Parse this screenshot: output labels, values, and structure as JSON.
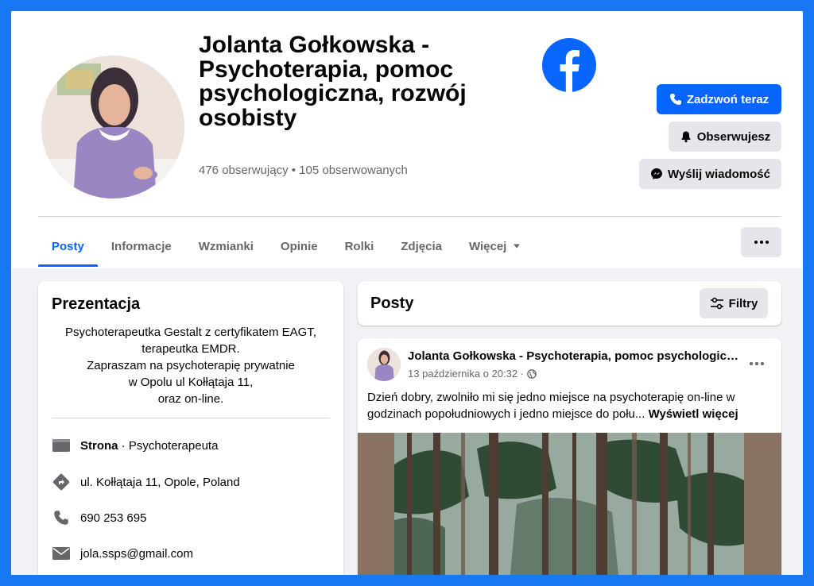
{
  "header": {
    "page_title": "Jolanta Gołkowska - Psychoterapia, pomoc psychologiczna, rozwój osobisty",
    "followers": "476 obserwujący • 105 obserwowanych"
  },
  "actions": {
    "call_label": "Zadzwoń teraz",
    "follow_label": "Obserwujesz",
    "message_label": "Wyślij wiadomość"
  },
  "tabs": [
    {
      "label": "Posty",
      "active": true
    },
    {
      "label": "Informacje"
    },
    {
      "label": "Wzmianki"
    },
    {
      "label": "Opinie"
    },
    {
      "label": "Rolki"
    },
    {
      "label": "Zdjęcia"
    },
    {
      "label": "Więcej"
    }
  ],
  "intro": {
    "title": "Prezentacja",
    "bio_lines": [
      "Psychoterapeutka Gestalt z certyfikatem EAGT,",
      "terapeutka EMDR.",
      "Zapraszam na psychoterapię prywatnie",
      "w Opolu ul Kołłątaja 11,",
      "oraz on-line."
    ],
    "page_type_label": "Strona",
    "page_type_value": " · Psychoterapeuta",
    "address": "ul. Kołłątaja 11, Opole, Poland",
    "phone": "690 253 695",
    "email": "jola.ssps@gmail.com"
  },
  "posts": {
    "title": "Posty",
    "filter_label": "Filtry"
  },
  "post": {
    "author": "Jolanta Gołkowska - Psychoterapia, pomoc psychologiczna, rozwój osobisty",
    "date": "13 października o 20:32 ·",
    "text": "Dzień dobry, zwolniło mi się jedno miejsce na psychoterapię on-line w godzinach popołudniowych i jedno miejsce do połu... ",
    "see_more": "Wyświetl więcej"
  },
  "colors": {
    "frame": "#1877f2",
    "accent": "#0866ff",
    "secondary_button": "#e4e6eb",
    "page_bg": "#f0f2f5"
  },
  "icons": [
    "facebook-logo-icon",
    "phone-icon",
    "bell-icon",
    "messenger-icon",
    "caret-down-icon",
    "filter-icon",
    "page-flag-icon",
    "directions-icon",
    "envelope-icon",
    "globe-icon"
  ]
}
